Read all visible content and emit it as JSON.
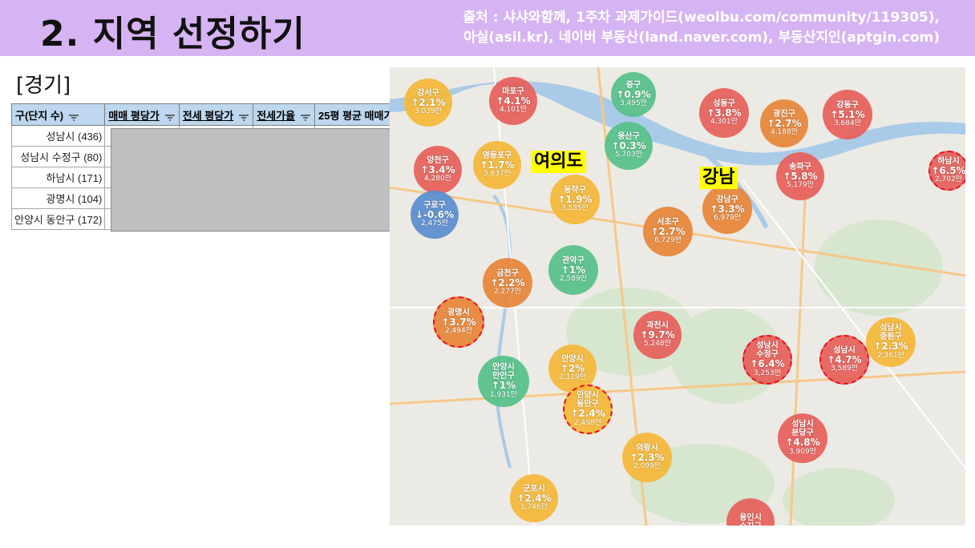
{
  "header": {
    "title": "2. 지역 선정하기",
    "source_line1": "출처 : 샤샤와함께, 1주차 과제가이드(weolbu.com/community/119305),",
    "source_line2": "아실(asil.kr), 네이버 부동산(land.naver.com), 부동산지인(aptgin.com)"
  },
  "region_label": "[경기]",
  "table": {
    "columns": [
      "구(단지 수)",
      "매매 평당가",
      "전세 평당가",
      "전세가율",
      "25평 평균 매매가"
    ],
    "rows": [
      "성남시 (436)",
      "성남시 수정구 (80)",
      "하남시 (171)",
      "광명시 (104)",
      "안양시 동안구 (172)"
    ]
  },
  "map": {
    "labels": [
      {
        "text": "여의도",
        "key": "yeouido"
      },
      {
        "text": "강남",
        "key": "gangnam"
      }
    ],
    "bubbles": [
      {
        "name": "강서구",
        "change": "↑2.1%",
        "price": "3,039만",
        "color": "#f5b93a",
        "highlight": false
      },
      {
        "name": "마포구",
        "change": "↑4.1%",
        "price": "4,101만",
        "color": "#e8615c",
        "highlight": false
      },
      {
        "name": "중구",
        "change": "↑0.9%",
        "price": "3,495만",
        "color": "#57c28a",
        "highlight": false
      },
      {
        "name": "성동구",
        "change": "↑3.8%",
        "price": "4,301만",
        "color": "#e8615c",
        "highlight": false
      },
      {
        "name": "광진구",
        "change": "↑2.7%",
        "price": "4,188만",
        "color": "#e8873a",
        "highlight": false
      },
      {
        "name": "강동구",
        "change": "↑5.1%",
        "price": "3,684만",
        "color": "#e8615c",
        "highlight": false
      },
      {
        "name": "용산구",
        "change": "↑0.3%",
        "price": "5,703만",
        "color": "#57c28a",
        "highlight": false
      },
      {
        "name": "양천구",
        "change": "↑3.4%",
        "price": "4,280만",
        "color": "#e8615c",
        "highlight": false
      },
      {
        "name": "영등포구",
        "change": "↑1.7%",
        "price": "3,637만",
        "color": "#f5b93a",
        "highlight": false
      },
      {
        "name": "송파구",
        "change": "↑5.8%",
        "price": "5,179만",
        "color": "#e8615c",
        "highlight": false
      },
      {
        "name": "하남시",
        "change": "↑6.5%",
        "price": "2,702만",
        "color": "#e8615c",
        "highlight": true
      },
      {
        "name": "동작구",
        "change": "↑1.9%",
        "price": "3,585만",
        "color": "#f5b93a",
        "highlight": false
      },
      {
        "name": "강남구",
        "change": "↑3.3%",
        "price": "6,979만",
        "color": "#e8873a",
        "highlight": false
      },
      {
        "name": "구로구",
        "change": "↓-0.6%",
        "price": "2,475만",
        "color": "#5b8fd0",
        "highlight": false
      },
      {
        "name": "서초구",
        "change": "↑2.7%",
        "price": "6,729만",
        "color": "#e8873a",
        "highlight": false
      },
      {
        "name": "금천구",
        "change": "↑2.2%",
        "price": "2,277만",
        "color": "#e8873a",
        "highlight": false
      },
      {
        "name": "관악구",
        "change": "↑1%",
        "price": "2,589만",
        "color": "#57c28a",
        "highlight": false
      },
      {
        "name": "광명시",
        "change": "↑3.7%",
        "price": "2,494만",
        "color": "#e8873a",
        "highlight": true
      },
      {
        "name": "과천시",
        "change": "↑9.7%",
        "price": "5,248만",
        "color": "#e8615c",
        "highlight": false
      },
      {
        "name": "성남시 수정구",
        "change": "↑6.4%",
        "price": "3,253만",
        "color": "#e8615c",
        "highlight": true
      },
      {
        "name": "성남시",
        "change": "↑4.7%",
        "price": "3,589만",
        "color": "#e8615c",
        "highlight": true
      },
      {
        "name": "성남시 중원구",
        "change": "↑2.3%",
        "price": "2,361만",
        "color": "#f5b93a",
        "highlight": false
      },
      {
        "name": "안양시",
        "change": "↑2%",
        "price": "2,319만",
        "color": "#f5b93a",
        "highlight": false
      },
      {
        "name": "안양시 만안구",
        "change": "↑1%",
        "price": "1,931만",
        "color": "#57c28a",
        "highlight": false
      },
      {
        "name": "안양시 동안구",
        "change": "↑2.4%",
        "price": "2,498만",
        "color": "#f5b93a",
        "highlight": true
      },
      {
        "name": "성남시 분당구",
        "change": "↑4.8%",
        "price": "3,909만",
        "color": "#e8615c",
        "highlight": false
      },
      {
        "name": "의왕시",
        "change": "↑2.3%",
        "price": "2,099만",
        "color": "#f5b93a",
        "highlight": false
      },
      {
        "name": "군포시",
        "change": "↑2.4%",
        "price": "1,746만",
        "color": "#f5b93a",
        "highlight": false
      },
      {
        "name": "용인시 수지구",
        "change": "",
        "price": "",
        "color": "#e8615c",
        "highlight": false
      }
    ]
  }
}
